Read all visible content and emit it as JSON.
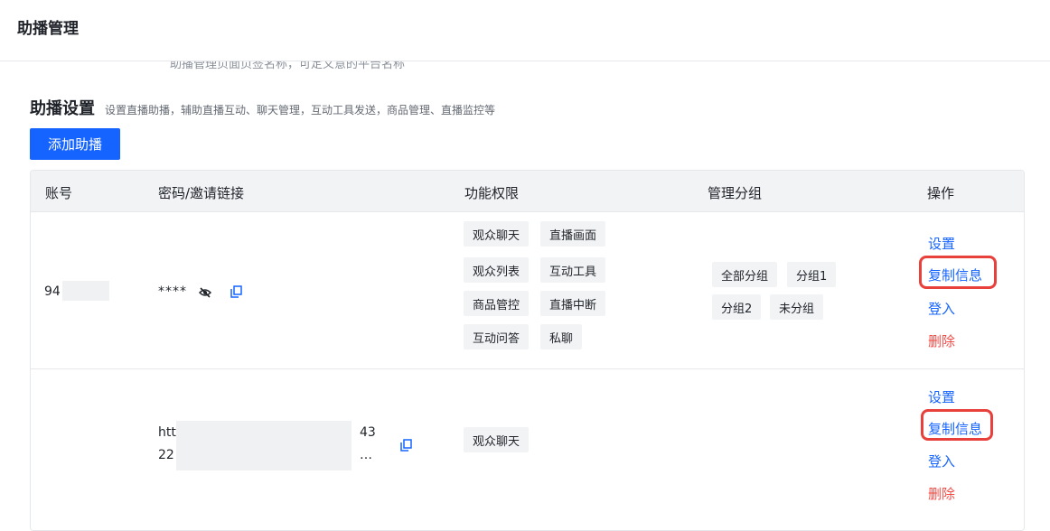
{
  "page": {
    "title": "助播管理",
    "cutoff_text": "助播管理页面页签名称，可定义意的平台名称"
  },
  "section": {
    "title": "助播设置",
    "description": "设置直播助播，辅助直播互动、聊天管理，互动工具发送，商品管理、直播监控等"
  },
  "add_button": "添加助播",
  "table": {
    "headers": [
      "账号",
      "密码/邀请链接",
      "功能权限",
      "管理分组",
      "操作"
    ],
    "rows": [
      {
        "account": "94",
        "password": "****",
        "permissions": [
          "观众聊天",
          "直播画面",
          "观众列表",
          "互动工具",
          "商品管控",
          "直播中断",
          "互动问答",
          "私聊"
        ],
        "groups": [
          "全部分组",
          "分组1",
          "分组2",
          "未分组"
        ],
        "actions": [
          "设置",
          "复制信息",
          "登入",
          "删除"
        ]
      },
      {
        "account": "",
        "link_line1_start": "htt",
        "link_line1_end": "43",
        "link_line2_start": "22",
        "link_line2_end": "…",
        "permissions": [
          "观众聊天"
        ],
        "groups": [],
        "actions": [
          "设置",
          "复制信息",
          "登入",
          "删除"
        ]
      }
    ]
  },
  "colors": {
    "primary": "#1664ff",
    "danger": "#f54a45",
    "highlight": "#e8403a",
    "tag_bg": "#f2f3f5"
  },
  "icons": {
    "eye": "eye-slash-icon",
    "copy": "copy-icon"
  }
}
